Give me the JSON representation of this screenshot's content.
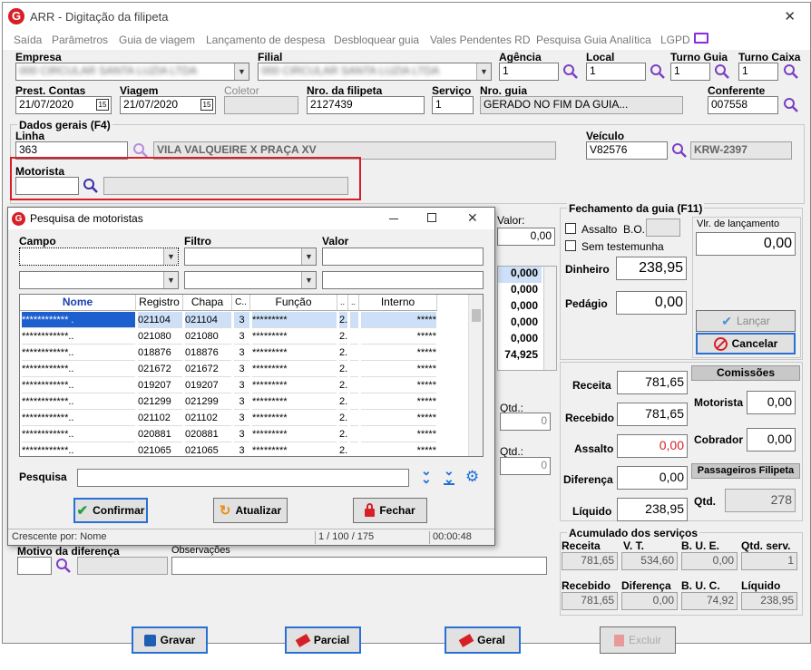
{
  "window": {
    "title": "ARR - Digitação da filipeta",
    "close": "✕"
  },
  "menu": [
    "Saída",
    "Parâmetros",
    "Guia de viagem",
    "Lançamento de despesa",
    "Desbloquear guia",
    "Vales Pendentes RD",
    "Pesquisa Guia Analítica",
    "LGPD"
  ],
  "header": {
    "empresa_label": "Empresa",
    "empresa_value": "000 CIRCULAR SANTA LUZIA LTDA",
    "filial_label": "Filial",
    "filial_value": "000 CIRCULAR SANTA LUZIA LTDA",
    "agencia_label": "Agência",
    "agencia_value": "1",
    "local_label": "Local",
    "local_value": "1",
    "turno_guia_label": "Turno Guia",
    "turno_guia_value": "1",
    "turno_caixa_label": "Turno Caixa",
    "turno_caixa_value": "1",
    "prest_label": "Prest. Contas",
    "prest_value": "21/07/2020",
    "viagem_label": "Viagem",
    "viagem_value": "21/07/2020",
    "coletor_label": "Coletor",
    "nro_filipeta_label": "Nro. da filipeta",
    "nro_filipeta_value": "2127439",
    "servico_label": "Serviço",
    "servico_value": "1",
    "nro_guia_label": "Nro. guia",
    "nro_guia_value": "GERADO NO FIM DA GUIA...",
    "conferente_label": "Conferente",
    "conferente_value": "007558"
  },
  "dados": {
    "title": "Dados gerais (F4)",
    "linha_label": "Linha",
    "linha_value": "363",
    "linha_desc": "VILA VALQUEIRE X PRAÇA XV",
    "veiculo_label": "Veículo",
    "veiculo_value": "V82576",
    "veiculo_desc": "KRW-2397",
    "motorista_label": "Motorista"
  },
  "background_partial": {
    "valor_label": "Valor:",
    "valor_first": "0,00",
    "values": [
      "0,000",
      "0,000",
      "0,000",
      "0,000",
      "0,000",
      "74,925"
    ],
    "qtd_label": "Qtd.:",
    "qtd1": "0",
    "qtd2": "0",
    "motivo_label": "Motivo da diferença",
    "obs_label": "Observações"
  },
  "fechamento": {
    "title": "Fechamento da guia (F11)",
    "assalto_label": "Assalto",
    "bo_label": "B.O.",
    "sem_label": "Sem testemunha",
    "dinheiro_label": "Dinheiro",
    "dinheiro": "238,95",
    "pedagio_label": "Pedágio",
    "pedagio": "0,00",
    "vlr_label": "Vlr. de lançamento",
    "vlr": "0,00",
    "lancar": "Lançar",
    "cancelar": "Cancelar"
  },
  "receita": {
    "receita_label": "Receita",
    "receita": "781,65",
    "recebido_label": "Recebido",
    "recebido": "781,65",
    "assalto_label": "Assalto",
    "assalto": "0,00",
    "diferenca_label": "Diferença",
    "diferenca": "0,00",
    "liquido_label": "Líquido",
    "liquido": "238,95"
  },
  "comissoes": {
    "title": "Comissões",
    "motorista_label": "Motorista",
    "motorista": "0,00",
    "cobrador_label": "Cobrador",
    "cobrador": "0,00"
  },
  "passageiros": {
    "title": "Passageiros Filipeta",
    "qtd_label": "Qtd.",
    "qtd": "278"
  },
  "acumulado": {
    "title": "Acumulado dos serviços",
    "receita_label": "Receita",
    "receita": "781,65",
    "vt_label": "V. T.",
    "vt": "534,60",
    "bue_label": "B. U. E.",
    "bue": "0,00",
    "qtd_label": "Qtd. serv.",
    "qtd": "1",
    "recebido_label": "Recebido",
    "recebido": "781,65",
    "diferenca_label": "Diferença",
    "diferenca": "0,00",
    "buc_label": "B. U. C.",
    "buc": "74,92",
    "liquido_label": "Líquido",
    "liquido": "238,95"
  },
  "footer": {
    "gravar": "Gravar",
    "parcial": "Parcial",
    "geral": "Geral",
    "excluir": "Excluir"
  },
  "dialog": {
    "title": "Pesquisa de motoristas",
    "campo_label": "Campo",
    "filtro_label": "Filtro",
    "valor_label": "Valor",
    "columns": [
      "Nome",
      "Registro",
      "Chapa",
      "C..",
      "Função",
      "..",
      "..",
      "Interno"
    ],
    "rows": [
      [
        "************ .",
        "021104",
        "021104",
        "3",
        "*********",
        "2.",
        "",
        "*****"
      ],
      [
        "************..",
        "021080",
        "021080",
        "3",
        "*********",
        "2.",
        "",
        "*****"
      ],
      [
        "************..",
        "018876",
        "018876",
        "3",
        "*********",
        "2.",
        "",
        "*****"
      ],
      [
        "************..",
        "021672",
        "021672",
        "3",
        "*********",
        "2.",
        "",
        "*****"
      ],
      [
        "************..",
        "019207",
        "019207",
        "3",
        "*********",
        "2.",
        "",
        "*****"
      ],
      [
        "************..",
        "021299",
        "021299",
        "3",
        "*********",
        "2.",
        "",
        "*****"
      ],
      [
        "************..",
        "021102",
        "021102",
        "3",
        "*********",
        "2.",
        "",
        "*****"
      ],
      [
        "************..",
        "020881",
        "020881",
        "3",
        "*********",
        "2.",
        "",
        "*****"
      ],
      [
        "************..",
        "021065",
        "021065",
        "3",
        "*********",
        "2.",
        "",
        "*****"
      ]
    ],
    "pesquisa_label": "Pesquisa",
    "confirmar": "Confirmar",
    "atualizar": "Atualizar",
    "fechar": "Fechar",
    "status_order": "Crescente por: Nome",
    "status_count": "1 / 100 / 175",
    "status_time": "00:00:48"
  },
  "colors": {
    "accent": "#2a6fd6",
    "search": "#7a3fc4",
    "highlight": "#d61f26",
    "selected_row": "#cde0f7"
  }
}
